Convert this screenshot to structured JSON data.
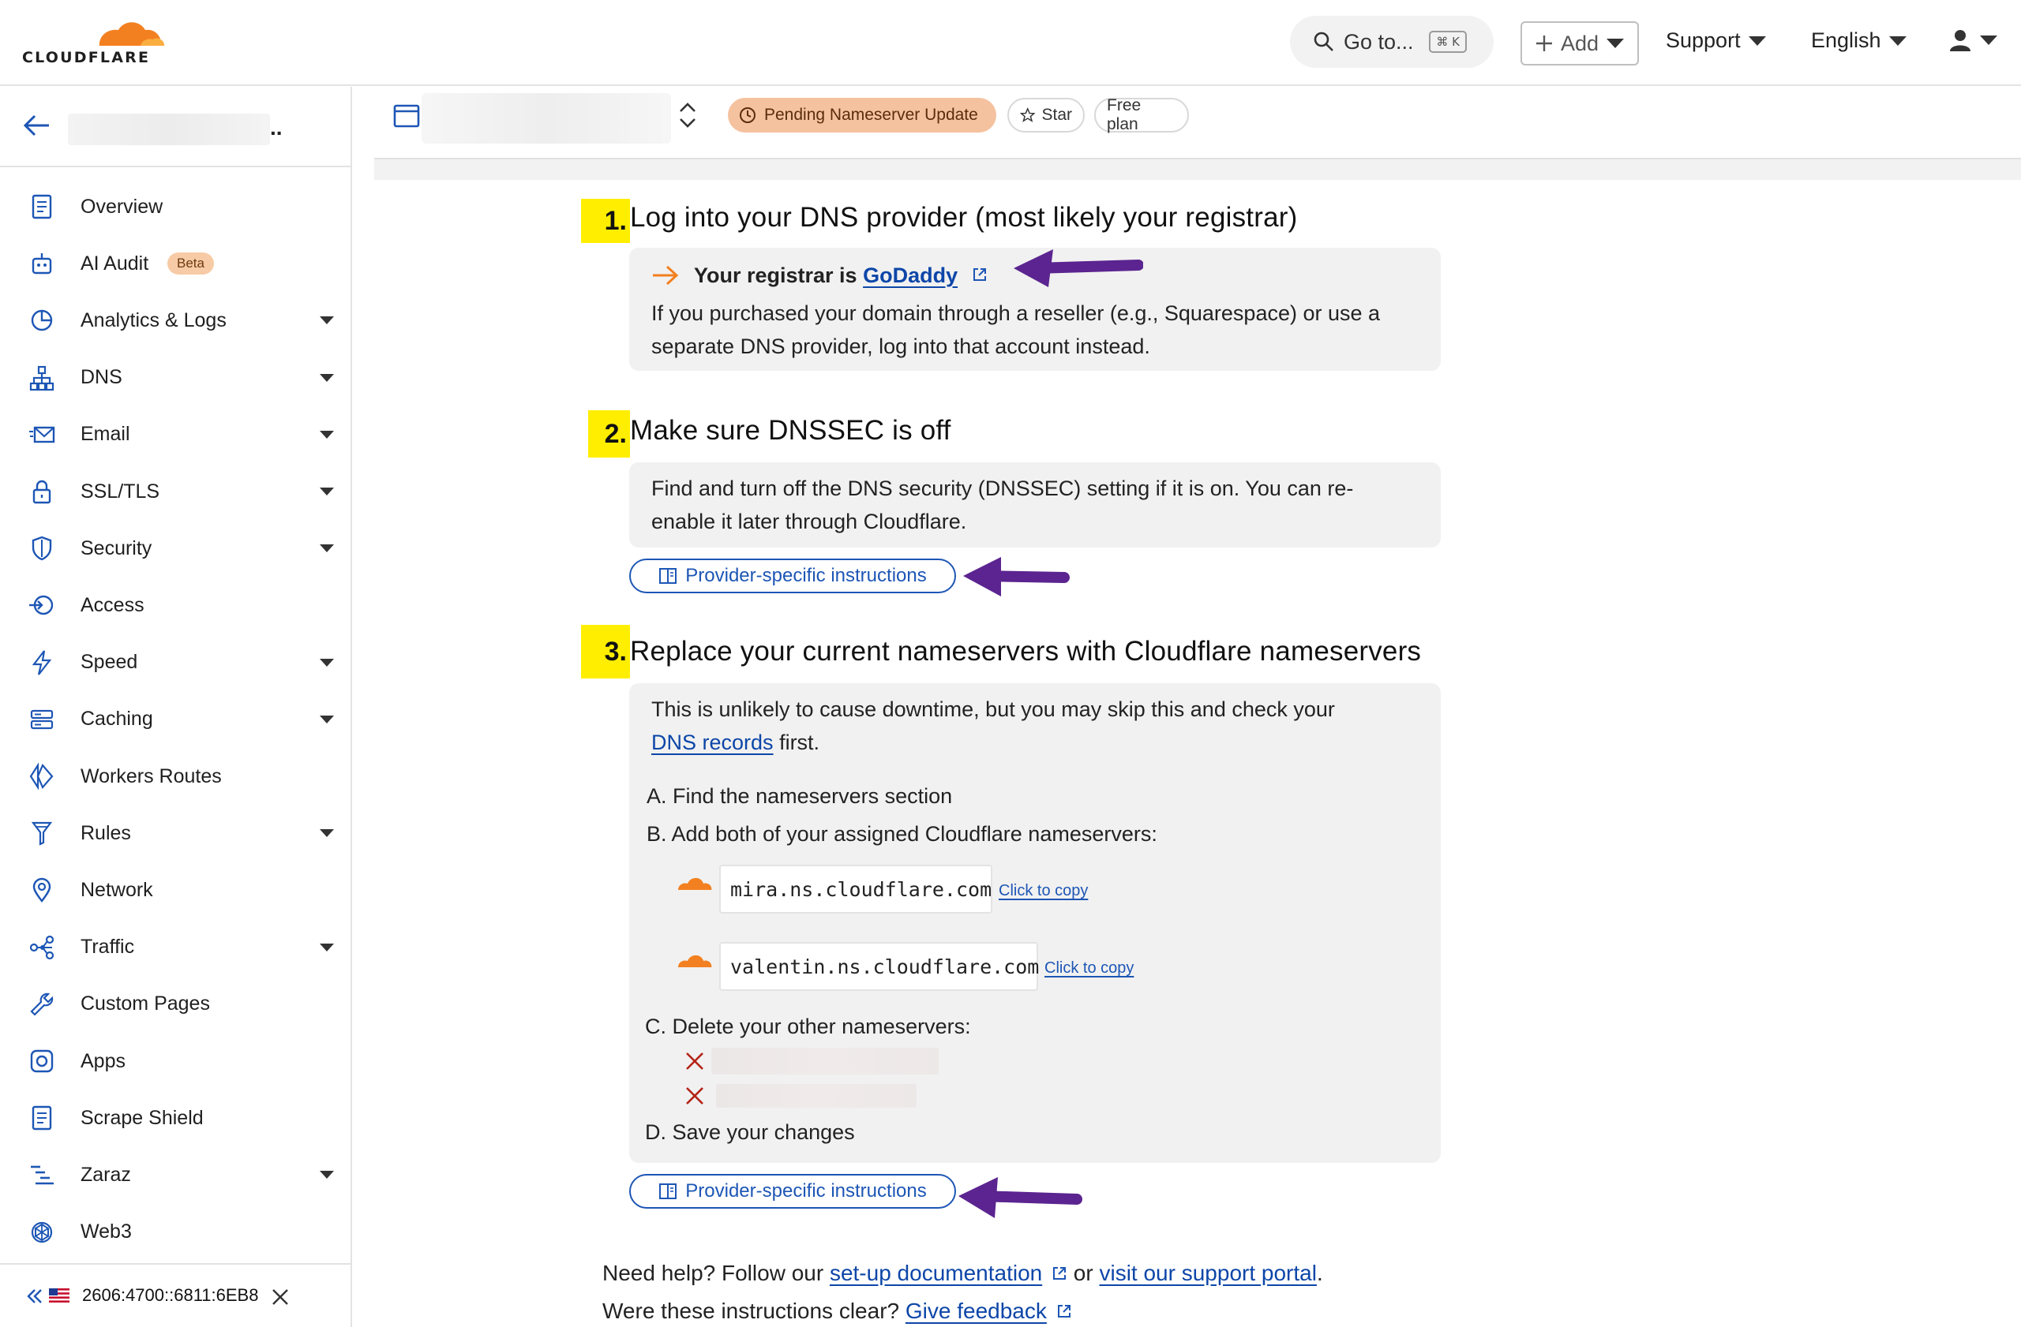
{
  "header": {
    "logo_text": "CLOUDFLARE",
    "goto_label": "Go to...",
    "goto_shortcut": "⌘ K",
    "add_label": "Add",
    "support_label": "Support",
    "language_label": "English"
  },
  "sidebar": {
    "dots": "..",
    "items": [
      {
        "label": "Overview",
        "icon": "document-icon",
        "has_caret": false
      },
      {
        "label": "AI Audit",
        "icon": "robot-icon",
        "has_caret": false,
        "badge": "Beta"
      },
      {
        "label": "Analytics & Logs",
        "icon": "pie-chart-icon",
        "has_caret": true
      },
      {
        "label": "DNS",
        "icon": "network-tree-icon",
        "has_caret": true
      },
      {
        "label": "Email",
        "icon": "envelope-icon",
        "has_caret": true
      },
      {
        "label": "SSL/TLS",
        "icon": "lock-icon",
        "has_caret": true
      },
      {
        "label": "Security",
        "icon": "shield-icon",
        "has_caret": true
      },
      {
        "label": "Access",
        "icon": "access-icon",
        "has_caret": false
      },
      {
        "label": "Speed",
        "icon": "lightning-icon",
        "has_caret": true
      },
      {
        "label": "Caching",
        "icon": "server-icon",
        "has_caret": true
      },
      {
        "label": "Workers Routes",
        "icon": "workers-icon",
        "has_caret": false
      },
      {
        "label": "Rules",
        "icon": "funnel-icon",
        "has_caret": true
      },
      {
        "label": "Network",
        "icon": "location-pin-icon",
        "has_caret": false
      },
      {
        "label": "Traffic",
        "icon": "share-nodes-icon",
        "has_caret": true
      },
      {
        "label": "Custom Pages",
        "icon": "wrench-icon",
        "has_caret": false
      },
      {
        "label": "Apps",
        "icon": "apps-icon",
        "has_caret": false
      },
      {
        "label": "Scrape Shield",
        "icon": "document-icon",
        "has_caret": false
      },
      {
        "label": "Zaraz",
        "icon": "zaraz-icon",
        "has_caret": true
      },
      {
        "label": "Web3",
        "icon": "web3-icon",
        "has_caret": false
      }
    ],
    "footer_ip": "2606:4700::6811:6EB8"
  },
  "zone": {
    "status_badge": "Pending Nameserver Update",
    "star_label": "Star",
    "plan_label": "Free plan"
  },
  "steps": {
    "step1": {
      "number": "1.",
      "title": "Log into your DNS provider (most likely your registrar)",
      "registrar_prefix": "Your registrar is",
      "registrar_name": "GoDaddy",
      "body_line1": "If you purchased your domain through a reseller (e.g., Squarespace) or use a",
      "body_line2": "separate DNS provider, log into that account instead."
    },
    "step2": {
      "number": "2.",
      "title": "Make sure DNSSEC is off",
      "body_line1": "Find and turn off the DNS security (DNSSEC) setting if it is on. You can re-",
      "body_line2": "enable it later through Cloudflare.",
      "button_label": "Provider-specific instructions"
    },
    "step3": {
      "number": "3.",
      "title": "Replace your current nameservers with Cloudflare nameservers",
      "body_line1": "This is unlikely to cause downtime, but you may skip this and check your",
      "dns_records_link": "DNS records",
      "body_line2_suffix": "first.",
      "sub_a": "A. Find the nameservers section",
      "sub_b": "B. Add both of your assigned Cloudflare nameservers:",
      "nameservers": [
        "mira.ns.cloudflare.com",
        "valentin.ns.cloudflare.com"
      ],
      "copy_label": "Click to copy",
      "sub_c": "C. Delete your other nameservers:",
      "sub_d": "D. Save your changes",
      "button_label": "Provider-specific instructions"
    }
  },
  "help": {
    "prefix": "Need help? Follow our",
    "docs_link": "set-up documentation",
    "or": "or",
    "support_link": "visit our support portal",
    "period": ".",
    "feedback_prefix": "Were these instructions clear?",
    "feedback_link": "Give feedback"
  },
  "colors": {
    "accent_orange": "#f38020",
    "link_blue": "#0d46a8",
    "highlight_yellow": "#ffee00",
    "annotation_purple": "#5b2490",
    "pending_badge": "#f5c2a0"
  }
}
